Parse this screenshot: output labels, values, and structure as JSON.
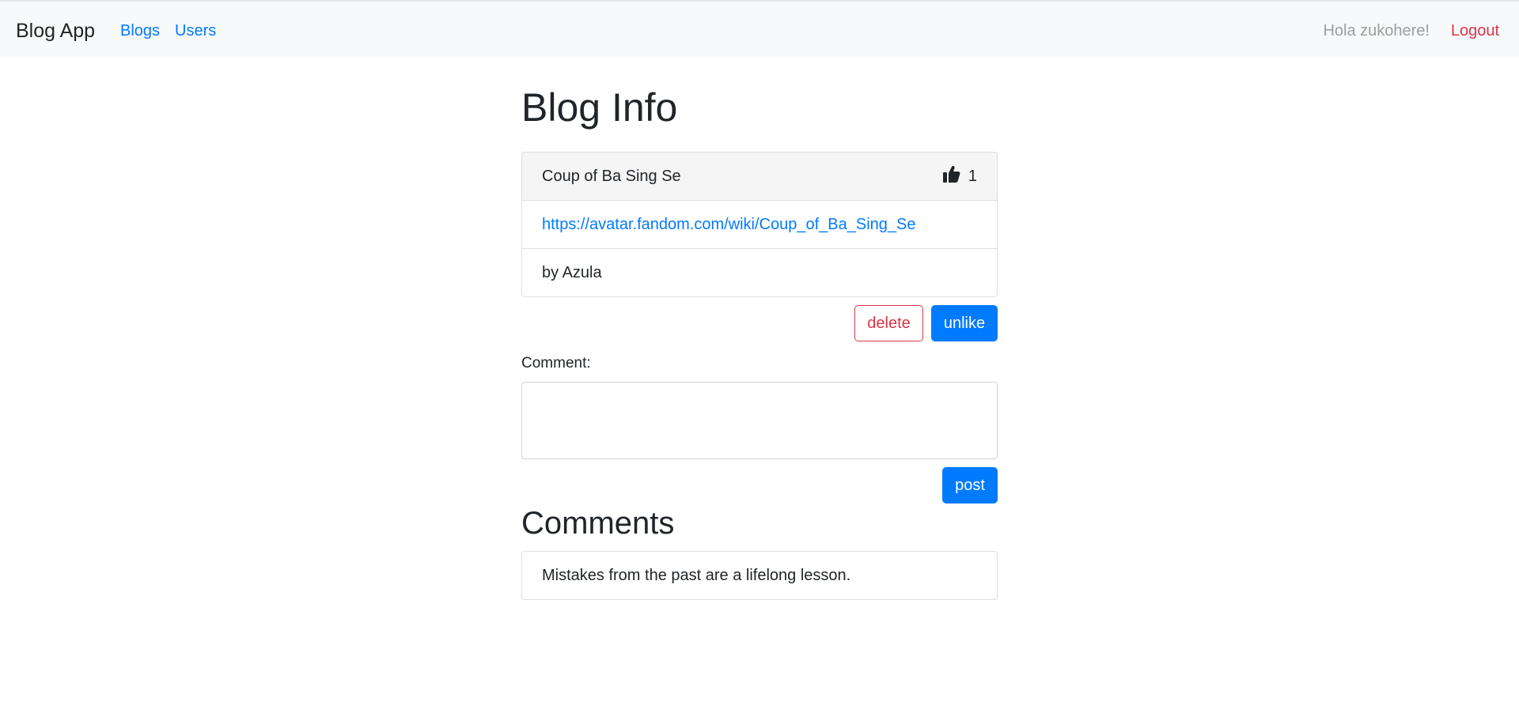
{
  "navbar": {
    "brand": "Blog App",
    "links": [
      "Blogs",
      "Users"
    ],
    "greeting": "Hola zukohere!",
    "logout": "Logout"
  },
  "page": {
    "title": "Blog Info"
  },
  "blog": {
    "title": "Coup of Ba Sing Se",
    "likes": "1",
    "url": "https://avatar.fandom.com/wiki/Coup_of_Ba_Sing_Se",
    "author_line": "by Azula",
    "like_icon": "thumbs-up-icon"
  },
  "actions": {
    "delete_label": "delete",
    "unlike_label": "unlike"
  },
  "comment_form": {
    "label": "Comment:",
    "value": "",
    "post_label": "post"
  },
  "comments": {
    "title": "Comments",
    "items": [
      "Mistakes from the past are a lifelong lesson."
    ]
  },
  "colors": {
    "primary": "#007bff",
    "danger": "#dc3545",
    "navbar_bg": "#f8f9fa"
  }
}
